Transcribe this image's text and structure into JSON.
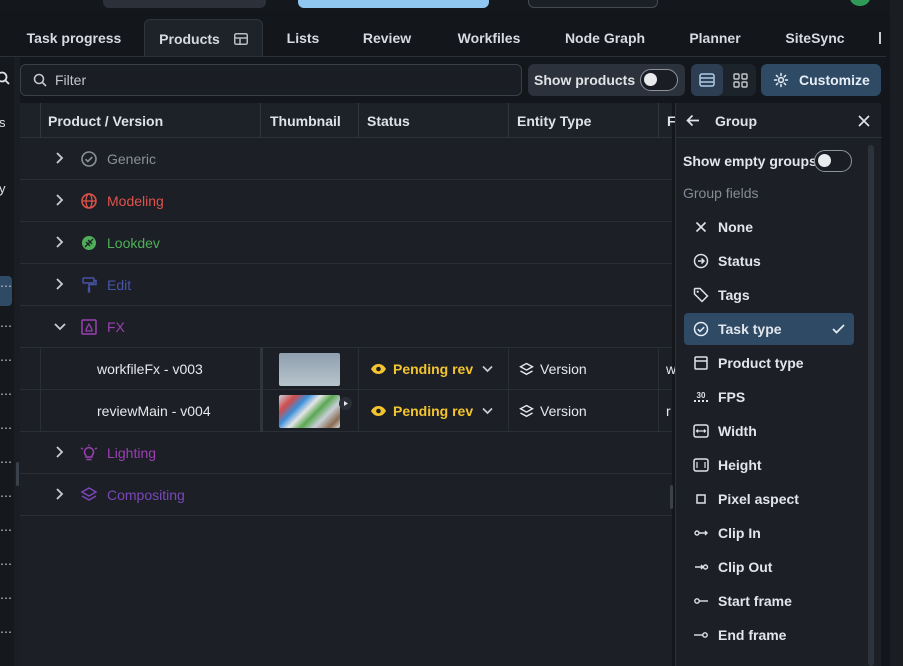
{
  "tabs": [
    {
      "label": "Task progress"
    },
    {
      "label": "Products"
    },
    {
      "label": "Lists"
    },
    {
      "label": "Review"
    },
    {
      "label": "Workfiles"
    },
    {
      "label": "Node Graph"
    },
    {
      "label": "Planner"
    },
    {
      "label": "SiteSync"
    }
  ],
  "toolbar": {
    "filter_placeholder": "Filter",
    "show_products_label": "Show products",
    "customize_label": "Customize"
  },
  "table": {
    "columns": [
      "Product / Version",
      "Thumbnail",
      "Status",
      "Entity Type",
      "F"
    ],
    "groups": [
      {
        "label": "Generic",
        "color": "#8a9099",
        "icon": "check-circle-icon"
      },
      {
        "label": "Modeling",
        "color": "#e0524a",
        "icon": "globe-icon"
      },
      {
        "label": "Lookdev",
        "color": "#4fae58",
        "icon": "leaf-icon"
      },
      {
        "label": "Edit",
        "color": "#4753a6",
        "icon": "paint-roller-icon"
      },
      {
        "label": "FX",
        "color": "#9b3fb3",
        "icon": "fx-icon"
      },
      {
        "label": "Lighting",
        "color": "#9b3fb3",
        "icon": "bulb-icon"
      },
      {
        "label": "Compositing",
        "color": "#7a47b8",
        "icon": "layers-icon"
      }
    ],
    "versions": [
      {
        "name": "workfileFx - v003",
        "status": "Pending revi",
        "entity_type": "Version",
        "extra": "w"
      },
      {
        "name": "reviewMain - v004",
        "status": "Pending revi",
        "entity_type": "Version",
        "extra": "r"
      }
    ],
    "status_color": "#f4c430"
  },
  "panel": {
    "title": "Group",
    "show_empty_label": "Show empty groups",
    "fields_label": "Group fields",
    "options": [
      {
        "label": "None",
        "icon": "x-icon"
      },
      {
        "label": "Status",
        "icon": "arrow-circle-icon"
      },
      {
        "label": "Tags",
        "icon": "tag-icon"
      },
      {
        "label": "Task type",
        "icon": "check-circle-icon",
        "selected": true
      },
      {
        "label": "Product type",
        "icon": "archive-icon"
      },
      {
        "label": "FPS",
        "icon": "fps-icon"
      },
      {
        "label": "Width",
        "icon": "width-icon"
      },
      {
        "label": "Height",
        "icon": "height-icon"
      },
      {
        "label": "Pixel aspect",
        "icon": "square-icon"
      },
      {
        "label": "Clip In",
        "icon": "clip-in-icon"
      },
      {
        "label": "Clip Out",
        "icon": "clip-out-icon"
      },
      {
        "label": "Start frame",
        "icon": "start-frame-icon"
      },
      {
        "label": "End frame",
        "icon": "end-frame-icon"
      }
    ],
    "fps_glyph": "30"
  },
  "left_strip": {
    "letters": [
      "s",
      "y"
    ]
  }
}
